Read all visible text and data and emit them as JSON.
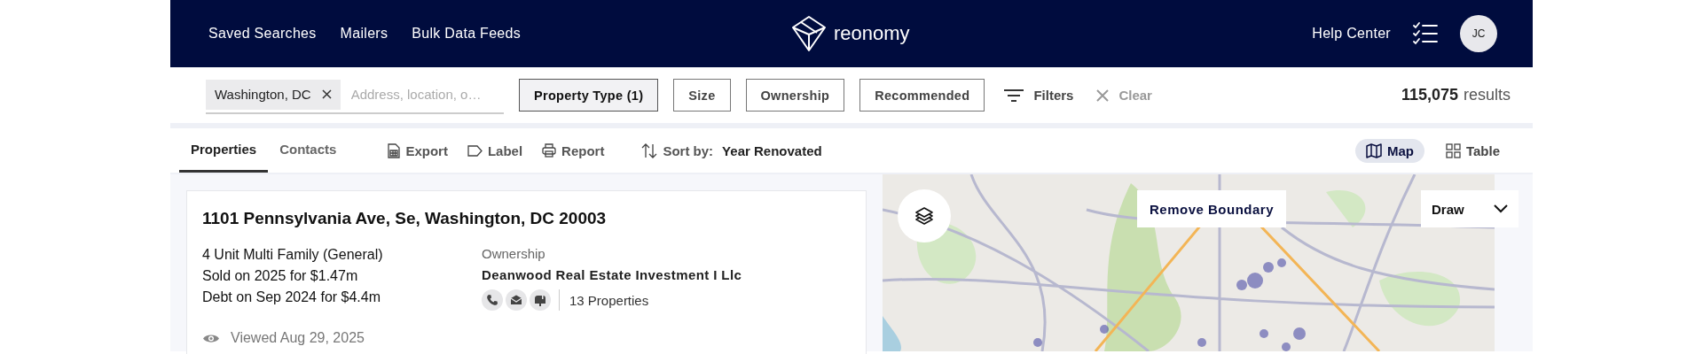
{
  "header": {
    "nav": [
      "Saved Searches",
      "Mailers",
      "Bulk Data Feeds"
    ],
    "logo": "reonomy",
    "help": "Help Center",
    "avatar": "JC"
  },
  "search": {
    "chips": [
      {
        "label": "Washington, DC"
      }
    ],
    "placeholder": "Address, location, o…"
  },
  "filters": [
    {
      "label": "Property Type (1)",
      "selected": true
    },
    {
      "label": "Size",
      "selected": false
    },
    {
      "label": "Ownership",
      "selected": false
    },
    {
      "label": "Recommended",
      "selected": false
    }
  ],
  "more_filters": "Filters",
  "clear": {
    "label": "Clear",
    "disabled": true
  },
  "results": {
    "count": "115,075",
    "label": "results"
  },
  "tabs": [
    {
      "label": "Properties",
      "selected": true
    },
    {
      "label": "Contacts",
      "selected": false
    }
  ],
  "actions": [
    {
      "kind": "export",
      "label": "Export"
    },
    {
      "kind": "label",
      "label": "Label"
    },
    {
      "kind": "report",
      "label": "Report"
    }
  ],
  "sort": {
    "prefix": "Sort by:",
    "value": "Year Renovated"
  },
  "views": [
    {
      "kind": "map",
      "label": "Map",
      "selected": true
    },
    {
      "kind": "table",
      "label": "Table",
      "selected": false
    }
  ],
  "card": {
    "title": "1101 Pennsylvania Ave, Se, Washington, DC 20003",
    "lines": [
      "4 Unit Multi Family (General)",
      "Sold on 2025 for $1.47m",
      "Debt on Sep 2024 for $4.4m"
    ],
    "ownership_label": "Ownership",
    "owner": "Deanwood Real Estate Investment I Llc",
    "properties": "13 Properties",
    "viewed": "Viewed Aug 29, 2025"
  },
  "map": {
    "kind": "picture",
    "remove_boundary": "Remove Boundary",
    "draw": "Draw"
  }
}
